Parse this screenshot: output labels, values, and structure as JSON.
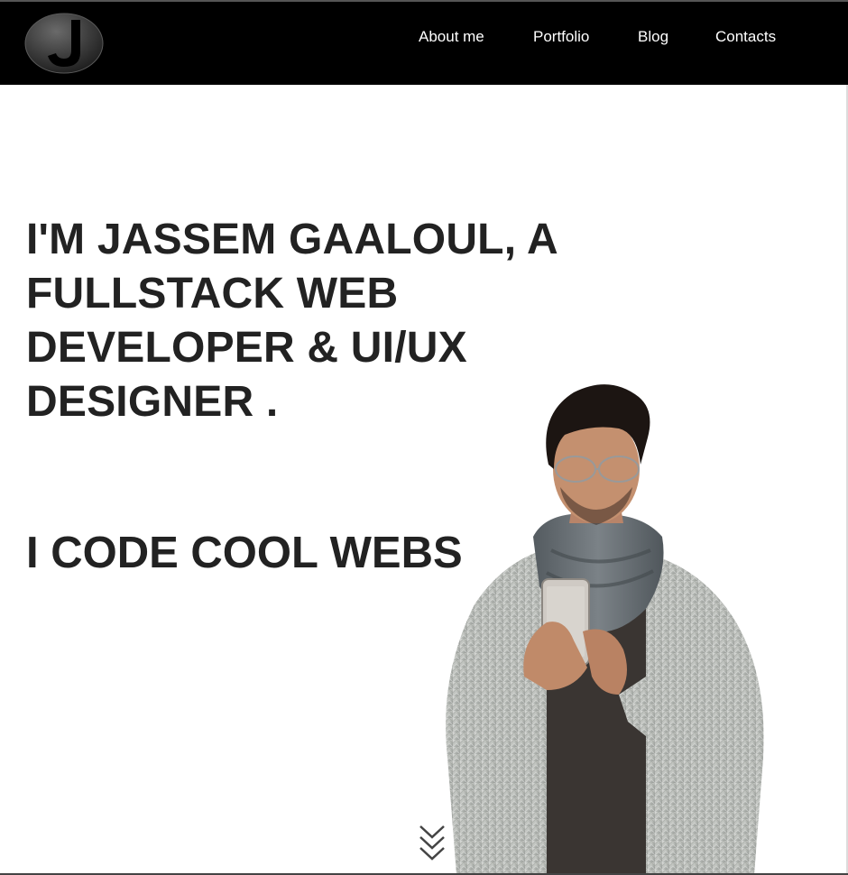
{
  "navbar": {
    "logo_letter": "J",
    "links": [
      {
        "label": "About me"
      },
      {
        "label": "Portfolio"
      },
      {
        "label": "Blog"
      },
      {
        "label": "Contacts"
      }
    ]
  },
  "hero": {
    "headline": "I'M JASSEM GAALOUL, A FULLSTACK WEB DEVELOPER & UI/UX DESIGNER .",
    "tagline": "I CODE COOL WEBS",
    "portrait_icon": "person-portrait-icon",
    "scroll_icon": "chevron-double-down-icon"
  },
  "colors": {
    "navbar_bg": "#000000",
    "nav_text": "#ffffff",
    "heading_text": "#222222",
    "page_bg": "#ffffff"
  }
}
